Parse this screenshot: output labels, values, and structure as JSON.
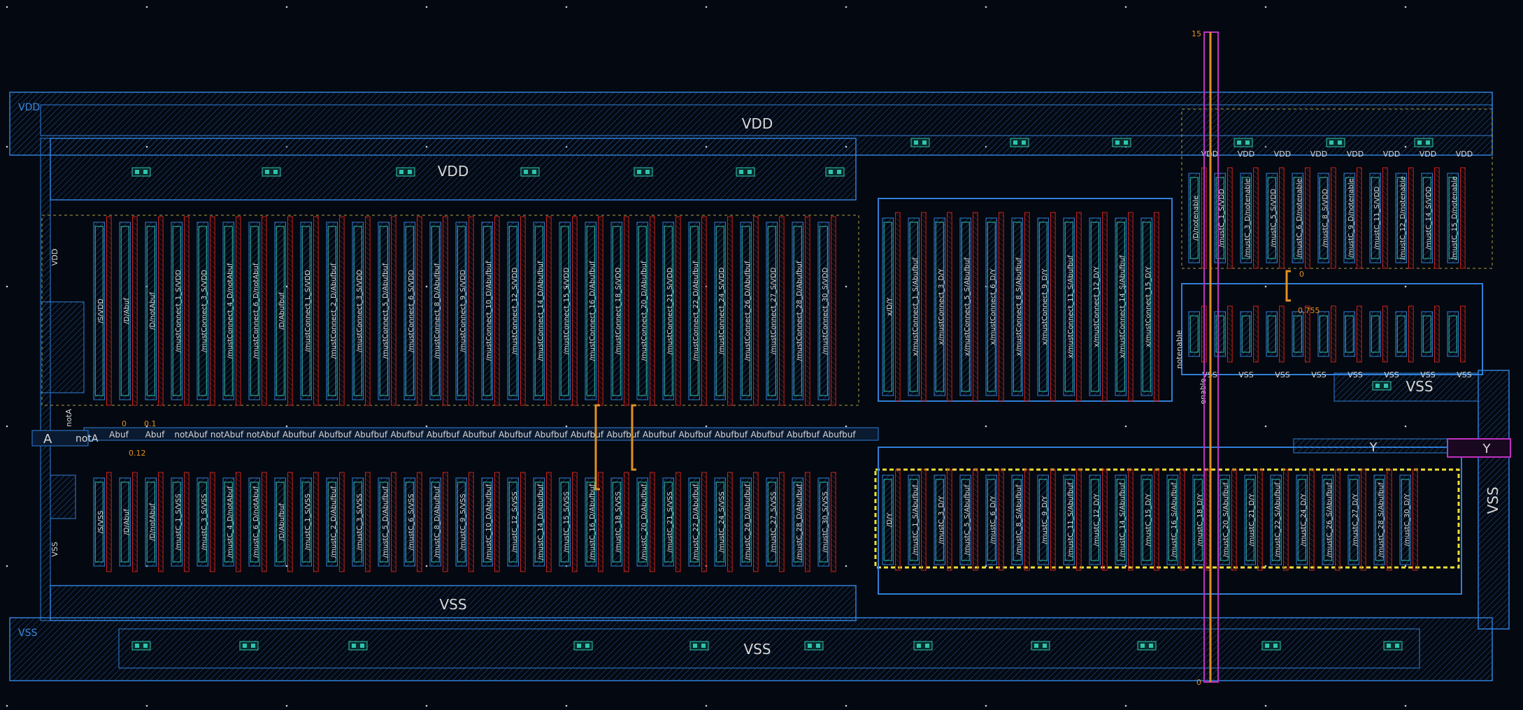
{
  "colors": {
    "background": "#040810",
    "metal1": "#2f7fd8",
    "poly": "#c8221c",
    "contact": "#2ec4b0",
    "highlight": "#f0e030",
    "ruler": "#e09020",
    "magenta": "#c030c0",
    "label": "#d8d8d8"
  },
  "supply_labels": {
    "vdd_rail_corner": "VDD",
    "vdd_top": "VDD",
    "vdd_left_block": "VDD",
    "vss_bottom_block": "VSS",
    "vss_rail_corner": "VSS",
    "vss_bottom": "VSS",
    "vss_right_block": "VSS",
    "vss_right_rail": "VSS",
    "vdd_vertical": "VDD",
    "vss_vertical": "VSS"
  },
  "port_labels": {
    "A": "A",
    "notA_box": "notA",
    "notA_vertical": "notA",
    "Y_box": "Y",
    "Y_mid": "Y",
    "notenable": "notenable",
    "enable": "enable"
  },
  "ruler": {
    "top_value": "15",
    "bottom_value": "0",
    "mid_value": "0.755",
    "right_value": "0",
    "left_small_1": "0",
    "left_small_2": "0.12",
    "left_small_3": "0.1"
  },
  "left_net_labels": [
    "Abuf",
    "Abuf",
    "notAbuf",
    "notAbuf",
    "notAbuf",
    "Abufbuf",
    "Abufbuf",
    "Abufbuf",
    "Abufbuf",
    "Abufbuf",
    "Abufbuf",
    "Abufbuf",
    "Abufbuf",
    "Abufbuf",
    "Abufbuf",
    "Abufbuf",
    "Abufbuf",
    "Abufbuf",
    "Abufbuf",
    "Abufbuf",
    "Abufbuf"
  ],
  "left_top_device_labels": [
    "/S/VDD",
    "/D/Abuf",
    "/D/notAbuf",
    "/mustConnect_1_S/VDD",
    "/mustConnect_3_S/VDD",
    "/mustConnect_4_D/notAbuf",
    "/mustConnect_6_D/notAbuf",
    "/D/Abufbuf",
    "/mustConnect_L_S/VDD",
    "/mustConnect_2_D/Abufbuf",
    "/mustConnect_3_S/VDD",
    "/mustConnect_5_D/Abufbuf",
    "/mustConnect_6_S/VDD",
    "/mustConnect_8_D/Abufbuf",
    "/mustConnect_9_S/VDD",
    "/mustConnect_10_D/Abufbuf",
    "/mustConnect_12_S/VDD",
    "/mustConnect_14_D/Abufbuf",
    "/mustConnect_15_S/VDD",
    "/mustConnect_16_D/Abufbuf",
    "/mustConnect_18_S/VDD",
    "/mustConnect_20_D/Abufbuf",
    "/mustConnect_21_S/VDD",
    "/mustConnect_22_D/Abufbuf",
    "/mustConnect_24_S/VDD",
    "/mustConnect_26_D/Abufbuf",
    "/mustConnect_27_S/VDD",
    "/mustConnect_28_D/Abufbuf",
    "/mustConnect_30_S/VDD"
  ],
  "left_bottom_device_labels": [
    "/S/VSS",
    "/D/Abuf",
    "/D/notAbuf",
    "/mustC_1_S/VSS",
    "/mustC_3_S/VSS",
    "/mustC_4_D/notAbuf",
    "/mustC_6_D/notAbuf",
    "/D/Abufbuf",
    "/mustC_1_S/VSS",
    "/mustC_2_D/Abufbuf",
    "/mustC_3_S/VSS",
    "/mustC_5_D/Abufbuf",
    "/mustC_6_S/VSS",
    "/mustC_8_D/Abufbuf",
    "/mustC_9_S/VSS",
    "/mustC_10_D/Abufbuf",
    "/mustC_12_S/VSS",
    "/mustC_14_D/Abufbuf",
    "/mustC_15_S/VSS",
    "/mustC_16_D/Abufbuf",
    "/mustC_18_S/VSS",
    "/mustC_20_D/Abufbuf",
    "/mustC_21_S/VSS",
    "/mustC_22_D/Abufbuf",
    "/mustC_24_S/VSS",
    "/mustC_26_D/Abufbuf",
    "/mustC_27_S/VSS",
    "/mustC_28_D/Abufbuf",
    "/mustC_30_S/VSS"
  ],
  "mid_top_device_labels": [
    "x/D/Y",
    "x/mustConnect_1_S/Abufbuf",
    "x/mustConnect_3_D/Y",
    "x/mustConnect_5_S/Abufbuf",
    "x/mustConnect_6_D/Y",
    "x/mustConnect_8_S/Abufbuf",
    "x/mustConnect_9_D/Y",
    "x/mustConnect_11_S/Abufbuf",
    "x/mustConnect_12_D/Y",
    "x/mustConnect_14_S/Abufbuf",
    "x/mustConnect_15_D/Y"
  ],
  "mid_bottom_device_labels": [
    "/D/Y",
    "/mustC_1_S/Abufbuf",
    "/mustC_3_D/Y",
    "/mustC_5_S/Abufbuf",
    "/mustC_6_D/Y",
    "/mustC_8_S/Abufbuf",
    "/mustC_9_D/Y",
    "/mustC_11_S/Abufbuf",
    "/mustC_12_D/Y",
    "/mustC_14_S/Abufbuf",
    "/mustC_15_D/Y",
    "/mustC_16_S/Abufbuf",
    "/mustC_18_D/Y",
    "/mustC_20_S/Abufbuf",
    "/mustC_21_D/Y",
    "/mustC_22_S/Abufbuf",
    "/mustC_24_D/Y",
    "/mustC_26_S/Abufbuf",
    "/mustC_27_D/Y",
    "/mustC_28_S/Abufbuf",
    "/mustC_30_D/Y"
  ],
  "right_top_device_labels": [
    "/D/notenable",
    "/mustC_1_S/VDD",
    "/mustC_3_D/notenable",
    "/mustC_5_S/VDD",
    "/mustC_6_D/notenable",
    "/mustC_8_S/VDD",
    "/mustC_9_D/notenable",
    "/mustC_11_S/VDD",
    "/mustC_12_D/notenable",
    "/mustC_14_S/VDD",
    "/mustC_15_D/notenable"
  ],
  "mid_vdd_labels": [
    "VDD",
    "VDD",
    "VDD",
    "VDD",
    "VDD",
    "VDD",
    "VDD",
    "VDD"
  ],
  "right_vss_labels": [
    "VSS",
    "VSS",
    "VSS",
    "VSS",
    "VSS",
    "VSS",
    "VSS",
    "VSS"
  ]
}
